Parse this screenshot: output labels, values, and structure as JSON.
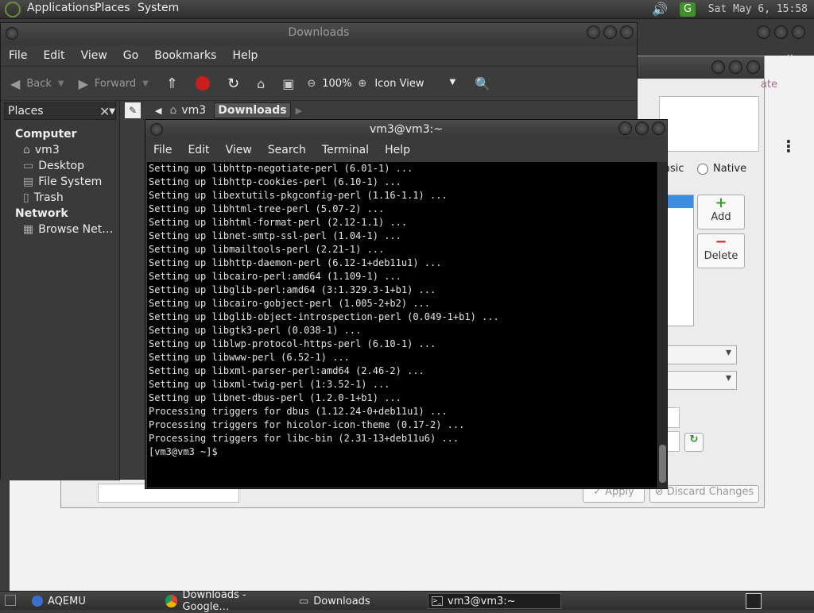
{
  "top_panel": {
    "menus": [
      "Applications",
      "Places",
      "System"
    ],
    "clock": "Sat May  6, 15:58"
  },
  "background_window": {
    "dialog_fragments": {
      "update_button_partial": "ate",
      "radio_basic_partial": "asic",
      "radio_native": "Native",
      "add_button": "Add",
      "delete_button": "Delete",
      "apply_button": "Apply",
      "discard_button": "Discard Changes"
    }
  },
  "file_manager": {
    "title": "Downloads",
    "menus": [
      "File",
      "Edit",
      "View",
      "Go",
      "Bookmarks",
      "Help"
    ],
    "toolbar": {
      "back": "Back",
      "forward": "Forward",
      "zoom": "100%",
      "view_mode": "Icon View"
    },
    "sidebar": {
      "title": "Places",
      "sections": [
        {
          "heading": "Computer",
          "items": [
            "vm3",
            "Desktop",
            "File System",
            "Trash"
          ]
        },
        {
          "heading": "Network",
          "items": [
            "Browse Net…"
          ]
        }
      ]
    },
    "path": [
      "vm3",
      "Downloads"
    ]
  },
  "terminal": {
    "title": "vm3@vm3:~",
    "menus": [
      "File",
      "Edit",
      "View",
      "Search",
      "Terminal",
      "Help"
    ],
    "lines": [
      "Setting up libhttp-negotiate-perl (6.01-1) ...",
      "Setting up libhttp-cookies-perl (6.10-1) ...",
      "Setting up libextutils-pkgconfig-perl (1.16-1.1) ...",
      "Setting up libhtml-tree-perl (5.07-2) ...",
      "Setting up libhtml-format-perl (2.12-1.1) ...",
      "Setting up libnet-smtp-ssl-perl (1.04-1) ...",
      "Setting up libmailtools-perl (2.21-1) ...",
      "Setting up libhttp-daemon-perl (6.12-1+deb11u1) ...",
      "Setting up libcairo-perl:amd64 (1.109-1) ...",
      "Setting up libglib-perl:amd64 (3:1.329.3-1+b1) ...",
      "Setting up libcairo-gobject-perl (1.005-2+b2) ...",
      "Setting up libglib-object-introspection-perl (0.049-1+b1) ...",
      "Setting up libgtk3-perl (0.038-1) ...",
      "Setting up liblwp-protocol-https-perl (6.10-1) ...",
      "Setting up libwww-perl (6.52-1) ...",
      "Setting up libxml-parser-perl:amd64 (2.46-2) ...",
      "Setting up libxml-twig-perl (1:3.52-1) ...",
      "Setting up libnet-dbus-perl (1.2.0-1+b1) ...",
      "Processing triggers for dbus (1.12.24-0+deb11u1) ...",
      "Processing triggers for hicolor-icon-theme (0.17-2) ...",
      "Processing triggers for libc-bin (2.31-13+deb11u6) ...",
      "[vm3@vm3 ~]$"
    ]
  },
  "taskbar": {
    "items": [
      "AQEMU",
      "Downloads - Google…",
      "Downloads",
      "vm3@vm3:~"
    ]
  }
}
